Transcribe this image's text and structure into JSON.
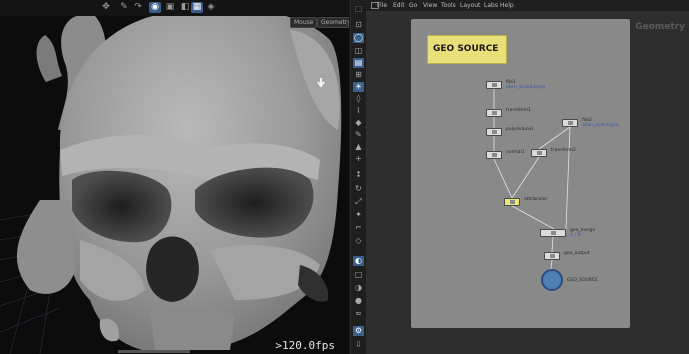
{
  "viewport": {
    "fps": ">120.0fps",
    "chips": [
      "Mouse",
      "Geometry"
    ],
    "toolbar_icons": [
      "transform-icon",
      "pen-icon",
      "curve-icon",
      "brush-icon",
      "view-icon",
      "snap-icon",
      "grid-icon",
      "display-icon"
    ],
    "side_tools": [
      "select-icon",
      "lock-icon",
      "lasso-icon",
      "camera-icon",
      "snap-icon",
      "grid-icon",
      "light-icon",
      "tag-icon",
      "brush-icon",
      "keyframe-icon",
      "pen-icon",
      "geometry-icon",
      "plus-icon",
      "move-icon",
      "rotate-icon",
      "scale-icon",
      "sculpt-icon",
      "bone-icon",
      "handle-icon",
      "display-icon",
      "render-icon",
      "shade-icon",
      "light-icon",
      "fog-icon",
      "settings-icon",
      "export-icon"
    ]
  },
  "network": {
    "menu": [
      "File",
      "Edit",
      "Go",
      "View",
      "Tools",
      "Layout",
      "Labs",
      "Help"
    ],
    "context_label": "Geometry",
    "sticky_title": "GEO SOURCE",
    "nodes": [
      {
        "id": "file1",
        "label": "file1",
        "sub": "alien_sculpt.bgeo",
        "kind": "plain"
      },
      {
        "id": "transform1",
        "label": "transform1",
        "kind": "plain"
      },
      {
        "id": "polyreduce1",
        "label": "polyreduce1",
        "kind": "plain"
      },
      {
        "id": "normal1",
        "label": "normal1",
        "kind": "plain"
      },
      {
        "id": "file2",
        "label": "file2",
        "sub": "alien_eyes.bgeo",
        "kind": "plain"
      },
      {
        "id": "transform2",
        "label": "transform2",
        "kind": "plain"
      },
      {
        "id": "attribcolor",
        "label": "attribcolor",
        "kind": "yellow"
      },
      {
        "id": "geo_merge",
        "label": "geo_merge",
        "sub": "A / B",
        "kind": "merge"
      },
      {
        "id": "geo_output",
        "label": "geo_output",
        "kind": "plain"
      },
      {
        "id": "GEO_SOURCE",
        "label": "GEO_SOURCE",
        "kind": "output"
      }
    ]
  }
}
